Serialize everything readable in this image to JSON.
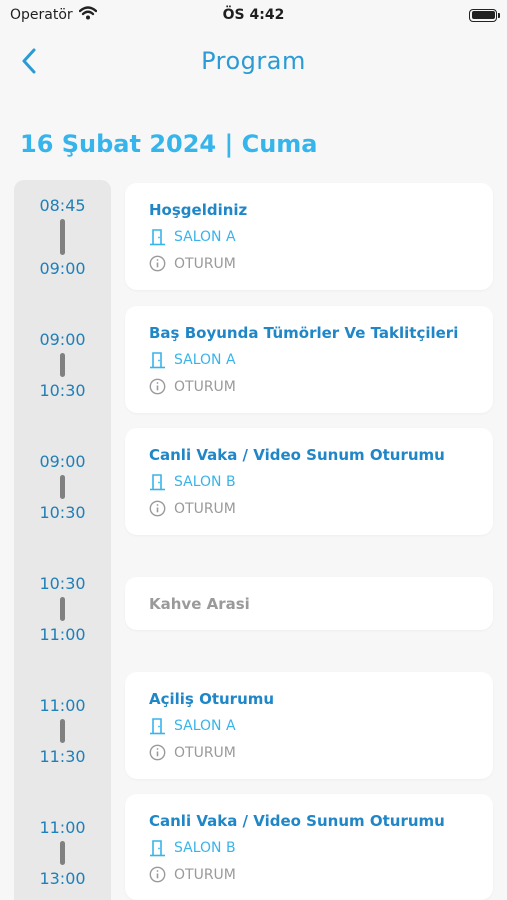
{
  "status": {
    "carrier": "Operatör",
    "time": "ÖS 4:42"
  },
  "nav": {
    "title": "Program"
  },
  "date": "16 Şubat 2024 | Cuma",
  "colors": {
    "accent": "#36b4ec",
    "title": "#1f86c7",
    "muted": "#9a9a9a"
  },
  "sessions": [
    {
      "start": "08:45",
      "end": "09:00",
      "title": "Hoşgeldiniz",
      "room": "SALON A",
      "type": "OTURUM"
    },
    {
      "start": "09:00",
      "end": "10:30",
      "title": "Baş Boyunda Tümörler Ve Taklitçileri",
      "room": "SALON A",
      "type": "OTURUM"
    },
    {
      "start": "09:00",
      "end": "10:30",
      "title": "Canli Vaka / Video Sunum Oturumu",
      "room": "SALON B",
      "type": "OTURUM"
    },
    {
      "start": "10:30",
      "end": "11:00",
      "title": "Kahve Arasi"
    },
    {
      "start": "11:00",
      "end": "11:30",
      "title": "Açiliş Oturumu",
      "room": "SALON A",
      "type": "OTURUM"
    },
    {
      "start": "11:00",
      "end": "13:00",
      "title": "Canli Vaka / Video Sunum Oturumu",
      "room": "SALON B",
      "type": "OTURUM"
    }
  ]
}
